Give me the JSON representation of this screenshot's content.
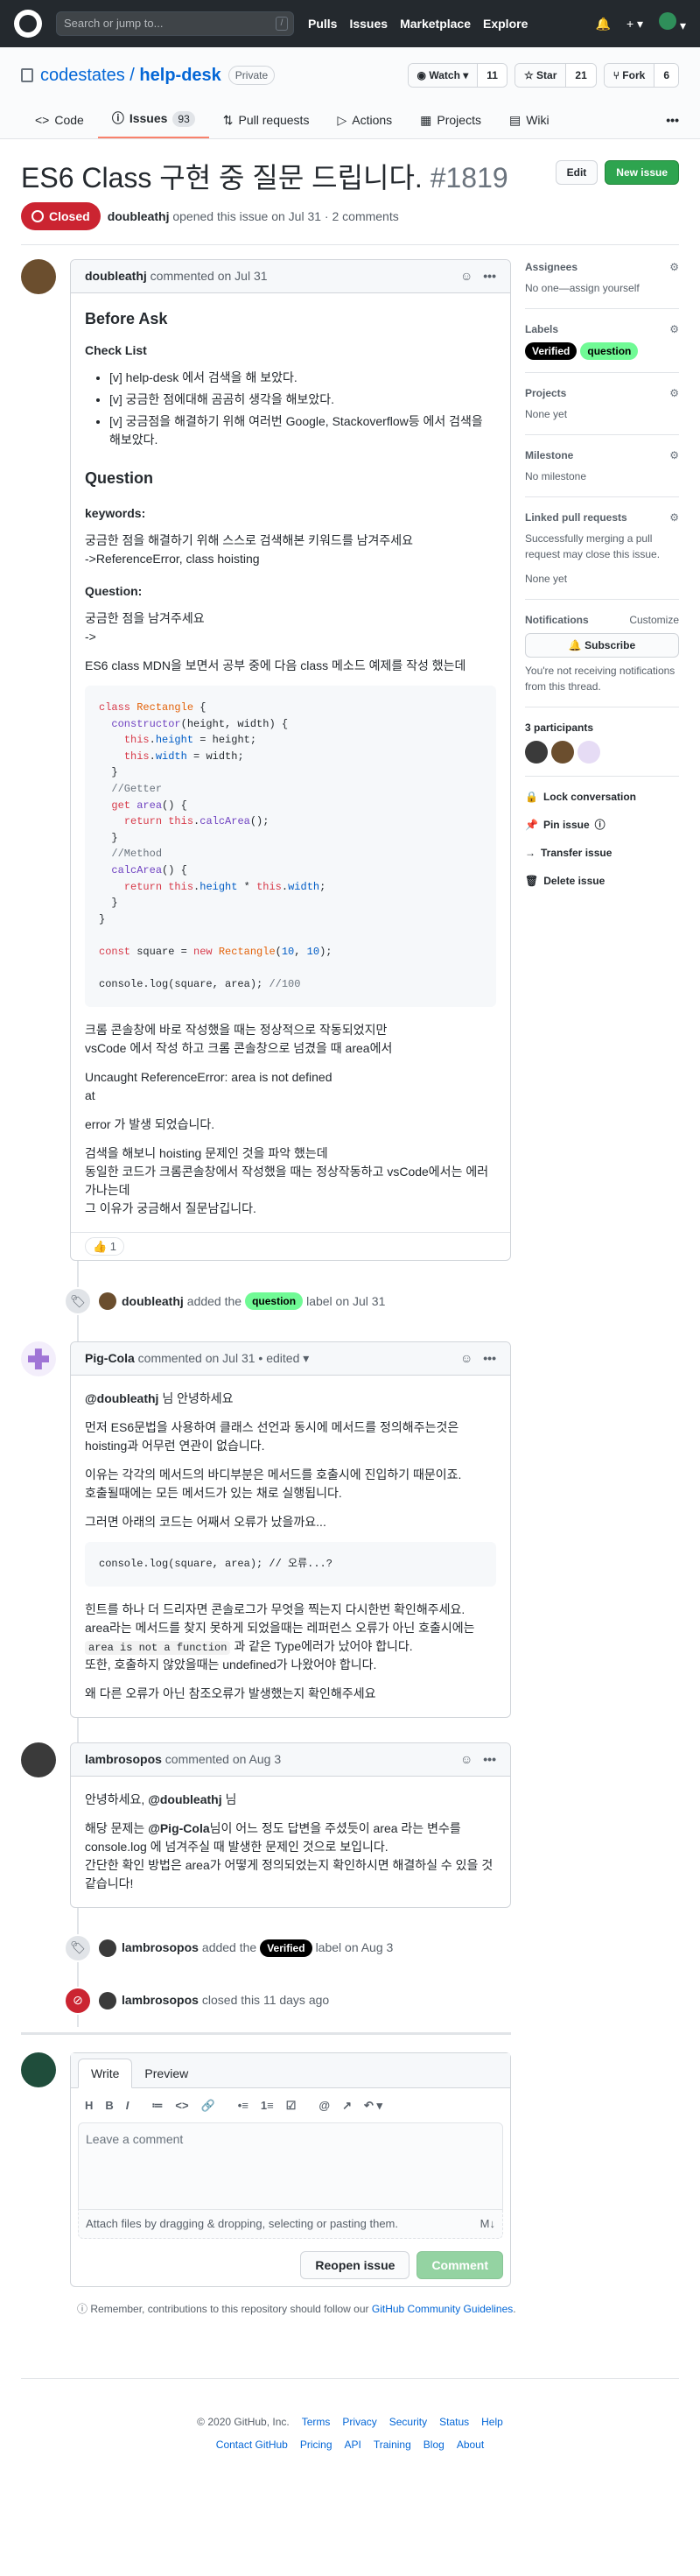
{
  "header": {
    "search_placeholder": "Search or jump to...",
    "search_key": "/",
    "nav": [
      "Pulls",
      "Issues",
      "Marketplace",
      "Explore"
    ],
    "plus": "+ ▾"
  },
  "repo": {
    "owner": "codestates",
    "sep": "/",
    "name": "help-desk",
    "visibility": "Private",
    "watch_label": "Watch ▾",
    "watch_count": "11",
    "star_label": "☆ Star",
    "star_count": "21",
    "fork_label": "Fork",
    "fork_count": "6",
    "tabs": [
      {
        "label": "Code"
      },
      {
        "label": "Issues",
        "count": "93"
      },
      {
        "label": "Pull requests"
      },
      {
        "label": "Actions"
      },
      {
        "label": "Projects"
      },
      {
        "label": "Wiki"
      }
    ],
    "more": "•••"
  },
  "issue": {
    "title": "ES6 Class 구현 중 질문 드립니다.",
    "number": "#1819",
    "edit": "Edit",
    "new_issue": "New issue",
    "state": "Closed",
    "author": "doubleathj",
    "meta_rest": "opened this issue on Jul 31 · 2 comments"
  },
  "comment1": {
    "author": "doubleathj",
    "when": "commented on Jul 31",
    "h_before": "Before Ask",
    "h_checklist": "Check List",
    "checks": [
      "[v] help-desk 에서 검색을 해 보았다.",
      "[v] 궁금한 점에대해 곰곰히 생각을 해보았다.",
      "[v] 궁금점을 해결하기 위해 여러번 Google, Stackoverflow등 에서 검색을 해보았다."
    ],
    "h_question": "Question",
    "h_keywords": "keywords:",
    "kw_line1": "궁금한 점을 해결하기 위해 스스로 검색해본 키워드를 남겨주세요",
    "kw_line2": "->ReferenceError, class hoisting",
    "h_q": "Question:",
    "q_line1": "궁금한 점을 남겨주세요",
    "q_line2": "->",
    "q_line3": "ES6 class MDN을 보면서 공부 중에 다음 class 메소드 예제를 작성 했는데",
    "p1a": "크롬 콘솔창에 바로 작성했을 때는 정상적으로 작동되었지만",
    "p1b": "vsCode 에서 작성 하고 크롬 콘솔창으로 넘겼을 때 area에서",
    "p2a": "Uncaught ReferenceError: area is not defined",
    "p2b": "at",
    "p3": "error 가 발생 되었습니다.",
    "p4a": "검색을 해보니 hoisting 문제인 것을 파악 했는데",
    "p4b": "동일한 코드가 크롬콘솔창에서 작성했을 때는 정상작동하고 vsCode에서는 에러가나는데",
    "p4c": "그 이유가 궁금해서 질문남깁니다.",
    "reaction": "👍 1"
  },
  "event_label": {
    "actor": "doubleathj",
    "text1": "added the",
    "label": "question",
    "text2": "label on Jul 31"
  },
  "comment2": {
    "author": "Pig-Cola",
    "when": "commented on Jul 31 • edited ▾",
    "mention": "@doubleathj",
    "greet": "님 안녕하세요",
    "p1a": "먼저 ES6문법을 사용하여 클래스 선언과 동시에 메서드를 정의해주는것은",
    "p1b": "hoisting과 어무런 연관이 없습니다.",
    "p2a": "이유는 각각의 메서드의 바디부분은 메서드를 호출시에 진입하기 때문이죠.",
    "p2b": "호출될때에는 모든 메서드가 있는 채로 실행됩니다.",
    "p3": "그러면 아래의 코드는 어째서 오류가 났을까요...",
    "code": "console.log(square, area); // 오류...?",
    "p4a": "힌트를 하나 더 드리자면 콘솔로그가 무엇을 찍는지 다시한번 확인해주세요.",
    "p4b": "area라는 메서드를 찾지 못하게 되었을때는 레퍼런스 오류가 아닌 호출시에는",
    "p4code": "area is not a function",
    "p4c": "과 같은 Type에러가 났어야 합니다.",
    "p4d": "또한, 호출하지 않았을때는 undefined가 나왔어야 합니다.",
    "p5": "왜 다른 오류가 아닌 참조오류가 발생했는지 확인해주세요"
  },
  "comment3": {
    "author": "lambrosopos",
    "when": "commented on Aug 3",
    "greet_a": "안녕하세요,",
    "greet_mention": "@doubleathj",
    "greet_b": "님",
    "p1a": "해당 문제는",
    "p1mention": "@Pig-Cola",
    "p1b": "님이 어느 정도 답변을 주셨듯이 area 라는 변수를 console.log 에 넘겨주실 때 발생한 문제인 것으로 보입니다.",
    "p1c": "간단한 확인 방법은 area가 어떻게 정의되었는지 확인하시면 해결하실 수 있을 것 같습니다!"
  },
  "event_verified": {
    "actor": "lambrosopos",
    "text1": "added the",
    "label": "Verified",
    "text2": "label on Aug 3"
  },
  "event_closed": {
    "actor": "lambrosopos",
    "text": "closed this 11 days ago"
  },
  "new_comment": {
    "tab_write": "Write",
    "tab_preview": "Preview",
    "toolbar": [
      "H",
      "B",
      "I",
      "≔",
      "<>",
      "🔗",
      "•≡",
      "1≡",
      "☑",
      "@",
      "↗",
      "↶ ▾"
    ],
    "placeholder": "Leave a comment",
    "attach": "Attach files by dragging & dropping, selecting or pasting them.",
    "md": "M↓",
    "reopen": "Reopen issue",
    "comment": "Comment",
    "tip_a": "Remember, contributions to this repository should follow our",
    "tip_link": "GitHub Community Guidelines",
    "tip_b": "."
  },
  "sidebar": {
    "assignees_h": "Assignees",
    "assignees_v": "No one—assign yourself",
    "labels_h": "Labels",
    "labels": [
      {
        "name": "Verified",
        "bg": "#000000",
        "fg": "#ffffff"
      },
      {
        "name": "question",
        "bg": "#70fa95",
        "fg": "#000000"
      }
    ],
    "projects_h": "Projects",
    "projects_v": "None yet",
    "milestone_h": "Milestone",
    "milestone_v": "No milestone",
    "linked_h": "Linked pull requests",
    "linked_v": "Successfully merging a pull request may close this issue.",
    "linked_v2": "None yet",
    "notif_h": "Notifications",
    "notif_customize": "Customize",
    "subscribe": "🔔 Subscribe",
    "notif_v": "You're not receiving notifications from this thread.",
    "participants_h": "3 participants",
    "lock": "Lock conversation",
    "pin": "Pin issue",
    "transfer": "Transfer issue",
    "delete": "Delete issue"
  },
  "footer": {
    "copyright": "© 2020 GitHub, Inc.",
    "row1": [
      "Terms",
      "Privacy",
      "Security",
      "Status",
      "Help"
    ],
    "row2": [
      "Contact GitHub",
      "Pricing",
      "API",
      "Training",
      "Blog",
      "About"
    ]
  },
  "colors": {
    "closed": "#cb2431",
    "accent": "#0366d6",
    "new_issue": "#2ea44f",
    "header_bg": "#24292e"
  }
}
